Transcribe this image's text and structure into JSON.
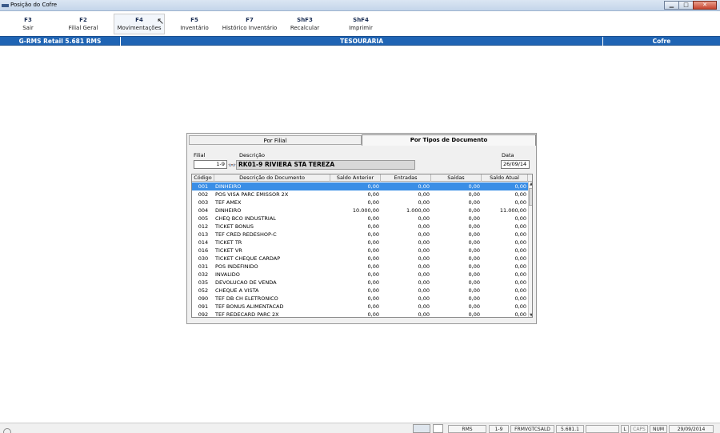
{
  "window": {
    "title": "Posição do Cofre",
    "buttons": [
      "minimize",
      "maximize",
      "close"
    ]
  },
  "toolbar": [
    {
      "key": "F3",
      "label": "Sair"
    },
    {
      "key": "F2",
      "label": "Filial Geral"
    },
    {
      "key": "F4",
      "label": "Movimentações"
    },
    {
      "key": "F5",
      "label": "Inventário"
    },
    {
      "key": "F7",
      "label": "Histórico Inventário"
    },
    {
      "key": "ShF3",
      "label": "Recalcular"
    },
    {
      "key": "ShF4",
      "label": "Imprimir"
    }
  ],
  "header": {
    "app": "G-RMS Retail 5.681 RMS",
    "module": "TESOURARIA",
    "section": "Cofre"
  },
  "tabs": {
    "by_branch": "Por Filial",
    "by_doc_type": "Por Tipos de Documento"
  },
  "form": {
    "filial_label": "Filial",
    "filial_value": "1-9",
    "descricao_label": "Descrição",
    "descricao_value": "RK01-9 RIVIERA STA TEREZA",
    "data_label": "Data",
    "data_value": "26/09/14"
  },
  "grid": {
    "columns": [
      "Código",
      "Descrição do Documento",
      "Saldo Anterior",
      "Entradas",
      "Saídas",
      "Saldo Atual"
    ],
    "rows": [
      [
        "001",
        "DINHEIRO",
        "0,00",
        "0,00",
        "0,00",
        "0,00"
      ],
      [
        "002",
        "POS VISA PARC EMISSOR  2X",
        "0,00",
        "0,00",
        "0,00",
        "0,00"
      ],
      [
        "003",
        "TEF AMEX",
        "0,00",
        "0,00",
        "0,00",
        "0,00"
      ],
      [
        "004",
        "DINHEIRO",
        "10.000,00",
        "1.000,00",
        "0,00",
        "11.000,00"
      ],
      [
        "005",
        "CHEQ BCO INDUSTRIAL",
        "0,00",
        "0,00",
        "0,00",
        "0,00"
      ],
      [
        "012",
        "TICKET BONUS",
        "0,00",
        "0,00",
        "0,00",
        "0,00"
      ],
      [
        "013",
        "TEF CRED REDESHOP-C",
        "0,00",
        "0,00",
        "0,00",
        "0,00"
      ],
      [
        "014",
        "TICKET TR",
        "0,00",
        "0,00",
        "0,00",
        "0,00"
      ],
      [
        "016",
        "TICKET VR",
        "0,00",
        "0,00",
        "0,00",
        "0,00"
      ],
      [
        "030",
        "TICKET CHEQUE CARDAP",
        "0,00",
        "0,00",
        "0,00",
        "0,00"
      ],
      [
        "031",
        "POS INDEFINIDO",
        "0,00",
        "0,00",
        "0,00",
        "0,00"
      ],
      [
        "032",
        "INVALIDO",
        "0,00",
        "0,00",
        "0,00",
        "0,00"
      ],
      [
        "035",
        "DEVOLUCAO DE VENDA",
        "0,00",
        "0,00",
        "0,00",
        "0,00"
      ],
      [
        "052",
        "CHEQUE A VISTA",
        "0,00",
        "0,00",
        "0,00",
        "0,00"
      ],
      [
        "090",
        "TEF DB CH ELETRONICO",
        "0,00",
        "0,00",
        "0,00",
        "0,00"
      ],
      [
        "091",
        "TEF BONUS ALIMENTACAD",
        "0,00",
        "0,00",
        "0,00",
        "0,00"
      ],
      [
        "092",
        "TEF REDECARD PARC 2X",
        "0,00",
        "0,00",
        "0,00",
        "0,00"
      ]
    ],
    "selected_row": 0
  },
  "statusbar": {
    "s1": "RMS",
    "s2": "1-9",
    "s3": "FRMVGTCSALD",
    "s4": "5.681.1",
    "s5": "L",
    "s6": "CAPS",
    "s7": "NUM",
    "s8": "29/09/2014"
  }
}
